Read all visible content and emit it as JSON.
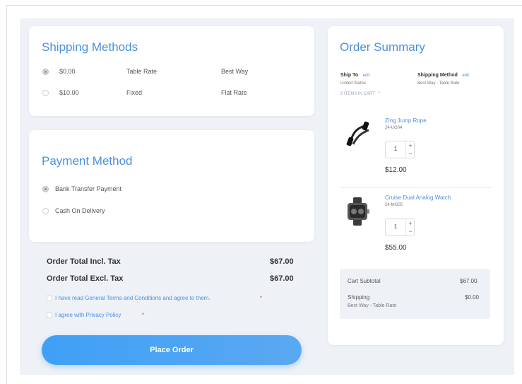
{
  "shipping": {
    "title": "Shipping Methods",
    "options": [
      {
        "price": "$0.00",
        "method": "Table Rate",
        "carrier": "Best Way",
        "selected": true
      },
      {
        "price": "$10.00",
        "method": "Fixed",
        "carrier": "Flat Rate",
        "selected": false
      }
    ]
  },
  "payment": {
    "title": "Payment Method",
    "options": [
      {
        "label": "Bank Transfer Payment",
        "selected": true
      },
      {
        "label": "Cash On Delivery",
        "selected": false
      }
    ]
  },
  "totals": {
    "incl_label": "Order Total Incl. Tax",
    "incl_value": "$67.00",
    "excl_label": "Order Total Excl. Tax",
    "excl_value": "$67.00"
  },
  "agreements": {
    "terms": "I have read General Terms and Conditions and agree to them.",
    "privacy": "I agree with Privacy Policy",
    "required_mark": "*"
  },
  "place_order_label": "Place Order",
  "summary": {
    "title": "Order Summary",
    "ship_to_label": "Ship To",
    "ship_to_value": "United States",
    "shipping_method_label": "Shipping Method",
    "shipping_method_value": "Best Way - Table Rate",
    "edit_label": "edit",
    "items_in_cart": "2 ITEMS IN CART",
    "items": [
      {
        "name": "Zing Jump Rope",
        "sku": "24-UG04",
        "qty": "1",
        "price": "$12.00",
        "icon": "jump-rope-icon"
      },
      {
        "name": "Cruise Dual Analog Watch",
        "sku": "24-MG05",
        "qty": "1",
        "price": "$55.00",
        "icon": "watch-icon"
      }
    ],
    "cart_subtotal_label": "Cart Subtotal",
    "cart_subtotal_value": "$67.00",
    "shipping_label": "Shipping",
    "shipping_sub": "Best Way - Table Rate",
    "shipping_value": "$0.00"
  },
  "colors": {
    "accent": "#4a90e2",
    "button": "#3fa0f5",
    "background": "#eef1f6",
    "required": "#e74c3c"
  }
}
